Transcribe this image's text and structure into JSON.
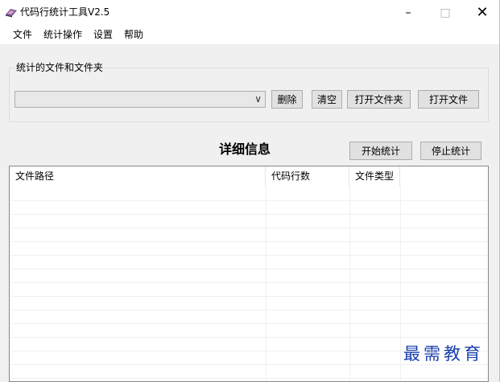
{
  "window": {
    "title": "代码行统计工具V2.5",
    "controls": {
      "minimize": "–",
      "maximize": "□",
      "close": "✕"
    }
  },
  "menu": [
    "文件",
    "统计操作",
    "设置",
    "帮助"
  ],
  "stats_group": {
    "label": "统计的文件和文件夹",
    "combo_value": "",
    "combo_arrow": "∨",
    "buttons": {
      "delete": "删除",
      "clear": "清空",
      "open_folder": "打开文件夹",
      "open_file": "打开文件"
    }
  },
  "details": {
    "title": "详细信息",
    "start": "开始统计",
    "stop": "停止统计"
  },
  "table": {
    "columns": [
      "文件路径",
      "代码行数",
      "文件类型"
    ],
    "rows": []
  },
  "watermark": "最需教育"
}
